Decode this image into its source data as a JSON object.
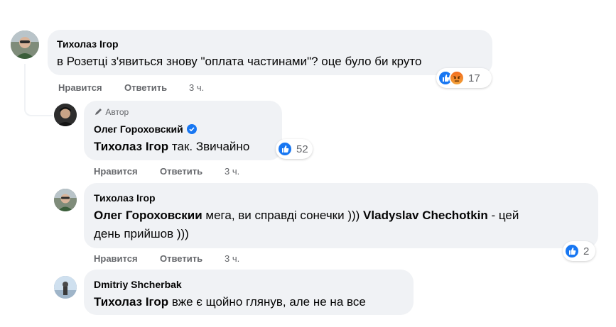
{
  "comments": [
    {
      "author": "Тихолаз Ігор",
      "text": "в Розетці з'явиться знову \"оплата частинами\"? оце було би круто",
      "actions": {
        "like": "Нравится",
        "reply": "Ответить",
        "time": "3 ч."
      },
      "reactions": {
        "icons": [
          "like-icon",
          "angry-icon"
        ],
        "count": "17"
      }
    },
    {
      "author_badge": "Автор",
      "author": "Олег Гороховский",
      "mention": "Тихолаз Ігор",
      "text": " так. Звичайно",
      "actions": {
        "like": "Нравится",
        "reply": "Ответить",
        "time": "3 ч."
      },
      "reactions": {
        "icons": [
          "like-icon"
        ],
        "count": "52"
      }
    },
    {
      "author": "Тихолаз Ігор",
      "mention1": "Олег Гороховскии",
      "text1": " мега, ви справді сонечки ))) ",
      "mention2": "Vladyslav Chechotkin",
      "text2": " - цей",
      "text3": "день прийшов )))",
      "actions": {
        "like": "Нравится",
        "reply": "Ответить",
        "time": "3 ч."
      },
      "reactions": {
        "icons": [
          "like-icon"
        ],
        "count": "2"
      }
    },
    {
      "author": "Dmitriy Shcherbak",
      "mention": "Тихолаз Ігор",
      "text": " вже є щойно глянув, але не на все"
    }
  ],
  "colors": {
    "bubble": "#f0f2f5",
    "like_blue": "#1877f2",
    "meta_gray": "#65676b"
  }
}
